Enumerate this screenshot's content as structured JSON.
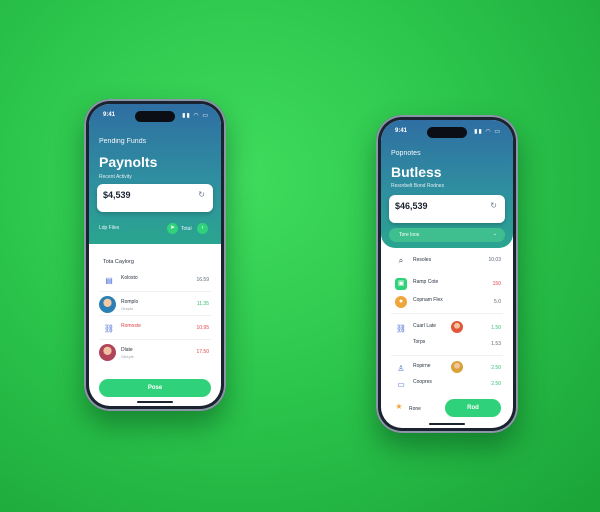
{
  "phone_left": {
    "header": {
      "small_label": "Pending Funds",
      "title": "Paynolts",
      "subtitle": "Recent Activity"
    },
    "balance": {
      "amount": "$​4,539",
      "sub": ""
    },
    "actions": {
      "link": "Ldp  Files",
      "pill_label": "Total"
    },
    "section_label": "Tota Caylorg",
    "rows": [
      {
        "name": "Kolosto",
        "sub": "",
        "amount": "16.59"
      },
      {
        "name": "Romplo",
        "sub": "Grepto",
        "amount": "11.35"
      },
      {
        "name": "Romoste",
        "sub": "",
        "amount": "10.95"
      },
      {
        "name": "Dlate",
        "sub": "Gtreyle",
        "amount": "17.50"
      }
    ],
    "cta": "Pose"
  },
  "phone_right": {
    "header": {
      "small_label": "Popnotes",
      "title": "Butless",
      "subtitle": "Resorbelt Bond Rodnes"
    },
    "balance": {
      "amount": "$46,539",
      "sub": ""
    },
    "pill_label": "Tore loos",
    "rows": [
      {
        "name": "Resoles",
        "amount": "10.03"
      },
      {
        "name": "Ramp Cote",
        "amount": "150"
      },
      {
        "name": "Copnam Flex",
        "amount": "5.0"
      },
      {
        "name": "Cuarl Late",
        "amount": "1.50"
      },
      {
        "name": "Torps",
        "amount": "1.53"
      },
      {
        "name": "Ropirne",
        "amount": "2.50"
      },
      {
        "name": "Coopres",
        "amount": "2.50"
      }
    ],
    "footer_label": "Rone",
    "cta": "Rod"
  },
  "status": {
    "time": "9:41",
    "icons": "▮▮ ◠ ▭"
  }
}
